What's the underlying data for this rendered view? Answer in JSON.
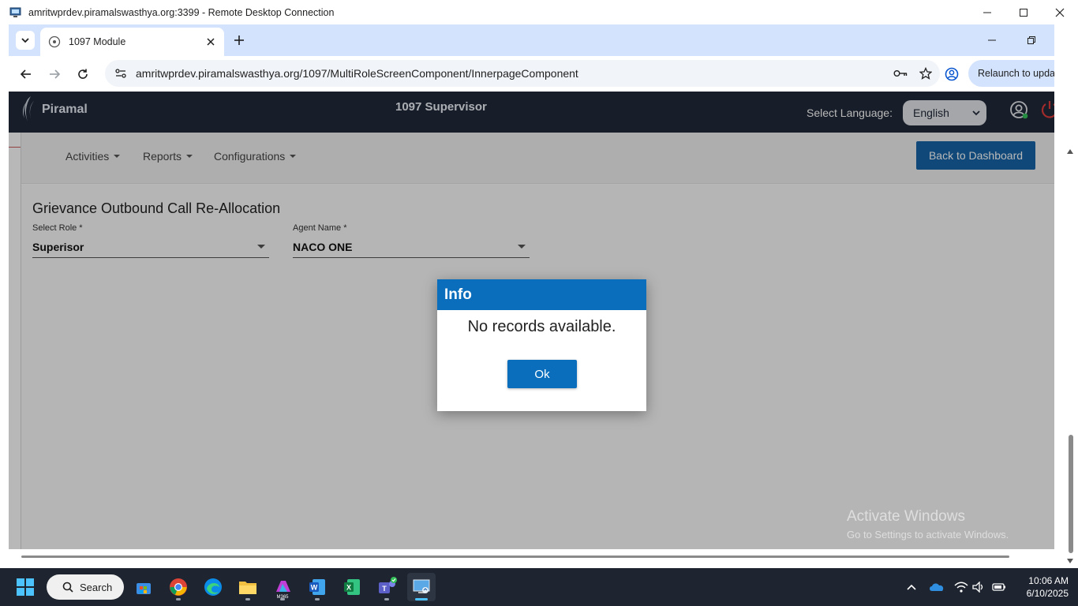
{
  "rdp": {
    "title": "amritwprdev.piramalswasthya.org:3399 - Remote Desktop Connection"
  },
  "browser": {
    "tab_title": "1097 Module",
    "url": "amritwprdev.piramalswasthya.org/1097/MultiRoleScreenComponent/InnerpageComponent",
    "relaunch_label": "Relaunch to updat"
  },
  "app": {
    "logo_text": "Piramal",
    "role_title": "1097 Supervisor",
    "language_label": "Select Language:",
    "language_value": "English",
    "nav": {
      "activities": "Activities",
      "reports": "Reports",
      "configurations": "Configurations",
      "back_button": "Back to Dashboard"
    },
    "panel": {
      "title": "Grievance Outbound Call Re-Allocation",
      "role_label": "Select Role *",
      "role_value": "Superisor",
      "agent_label": "Agent Name *",
      "agent_value": "NACO ONE"
    }
  },
  "dialog": {
    "title": "Info",
    "message": "No records available.",
    "ok_label": "Ok"
  },
  "watermark": {
    "line1": "Activate Windows",
    "line2": "Go to Settings to activate Windows."
  },
  "taskbar": {
    "search_label": "Search",
    "time": "10:06 AM",
    "date": "6/10/2025",
    "m365_badge": "M365"
  },
  "colors": {
    "header_bg": "#20293a",
    "primary_blue": "#1565a8",
    "dialog_blue": "#0a6ebd",
    "chrome_tabstrip": "#d3e3fd"
  }
}
